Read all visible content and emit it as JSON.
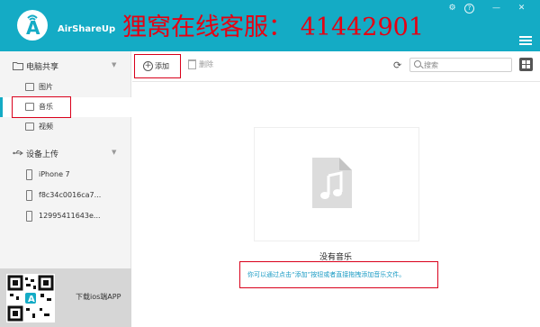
{
  "app": {
    "name": "AirShareUp",
    "watermark": "狸窝在线客服： 41442901"
  },
  "window_controls": {
    "settings": "⚙",
    "help": "?",
    "minimize": "—",
    "close": "✕"
  },
  "sidebar": {
    "computer_share": {
      "label": "电脑共享",
      "items": [
        {
          "label": "图片",
          "icon": "image-icon"
        },
        {
          "label": "音乐",
          "icon": "music-icon"
        },
        {
          "label": "视频",
          "icon": "video-icon"
        }
      ]
    },
    "device_upload": {
      "label": "设备上传",
      "devices": [
        {
          "label": "iPhone 7"
        },
        {
          "label": "f8c34c0016ca7..."
        },
        {
          "label": "12995411643e..."
        }
      ]
    },
    "qr_panel": {
      "label": "下载ios端APP"
    }
  },
  "toolbar": {
    "add_label": "添加",
    "delete_label": "删除",
    "search_placeholder": "搜索"
  },
  "main": {
    "empty_title": "没有音乐",
    "empty_hint": "你可以通过点击“添加”按钮或者直接拖拽添加音乐文件。"
  },
  "colors": {
    "header": "#14abc5",
    "highlight_frame": "#d9001b",
    "watermark": "#e60012",
    "hint_text": "#1a9bc4"
  }
}
